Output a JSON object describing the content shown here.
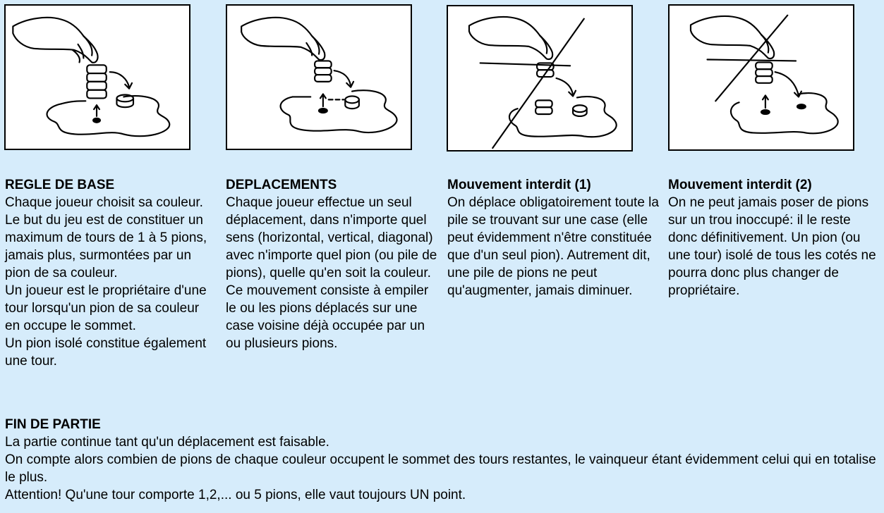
{
  "columns": [
    {
      "title": "REGLE DE BASE",
      "paragraphs": [
        "Chaque joueur choisit sa couleur.",
        "Le but du jeu est de constituer un maximum de tours de 1 à 5 pions, jamais plus, surmontées par un pion de sa couleur.",
        "Un joueur est le propriétaire d'une tour lorsqu'un pion de sa couleur en occupe le sommet.",
        "Un pion isolé constitue également une tour."
      ]
    },
    {
      "title": "DEPLACEMENTS",
      "paragraphs": [
        "Chaque joueur effectue un seul déplacement, dans n'importe quel sens (horizontal, vertical, diagonal) avec n'importe quel pion (ou pile de pions), quelle qu'en soit la couleur. Ce mouvement consiste à empiler le ou les pions déplacés sur une case voisine déjà occupée par un ou plusieurs pions."
      ]
    },
    {
      "title": "Mouvement interdit (1)",
      "paragraphs": [
        "On déplace obligatoirement toute la pile se trouvant sur une case (elle peut évidemment n'être constituée que d'un seul pion). Autrement dit, une pile de pions ne peut qu'augmenter, jamais diminuer."
      ]
    },
    {
      "title": "Mouvement interdit (2)",
      "paragraphs": [
        "On ne peut jamais poser de pions sur un trou inoccupé: il le reste donc définitivement. Un pion (ou une tour) isolé de tous les cotés ne pourra donc plus changer de propriétaire."
      ]
    }
  ],
  "fin": {
    "title": "FIN DE PARTIE",
    "paragraphs": [
      "La partie continue tant qu'un déplacement est faisable.",
      "On compte alors combien de pions de chaque couleur occupent le sommet des tours restantes, le vainqueur étant évidemment celui qui en totalise le plus.",
      "Attention! Qu'une tour comporte 1,2,... ou 5 pions, elle vaut toujours UN point."
    ]
  },
  "colors": {
    "background": "#d6ecfb",
    "ink": "#000000"
  },
  "illustrations": [
    {
      "icon": "hand-moving-stack-icon"
    },
    {
      "icon": "hand-moving-stack-icon"
    },
    {
      "icon": "crossed-out-partial-stack-icon"
    },
    {
      "icon": "crossed-out-empty-hole-icon"
    }
  ]
}
